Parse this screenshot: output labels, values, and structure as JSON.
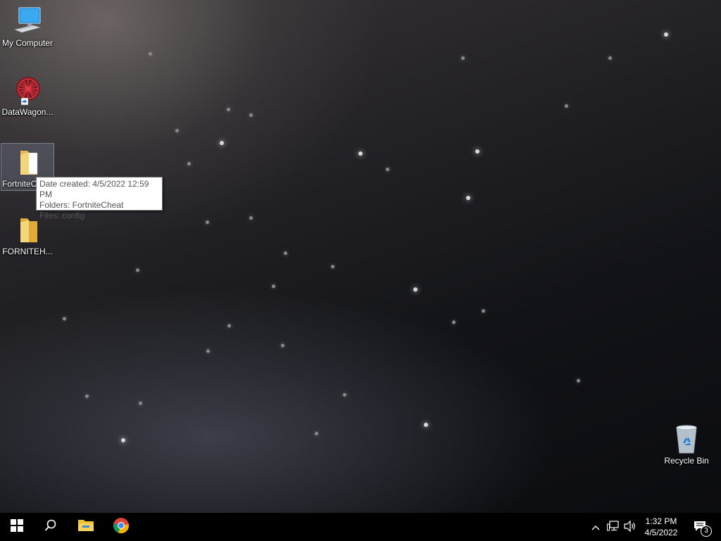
{
  "desktop": {
    "icons": [
      {
        "label": "My Computer"
      },
      {
        "label": "DataWagon..."
      },
      {
        "label": "FortniteC"
      },
      {
        "label": "FORNITEH..."
      },
      {
        "label": "Recycle Bin"
      }
    ],
    "tooltip": {
      "date_created": "Date created: 4/5/2022 12:59 PM",
      "folders": "Folders: FortniteCheat",
      "files": "Files: config"
    }
  },
  "taskbar": {
    "buttons": [
      "start-icon",
      "search-icon",
      "file-explorer-icon",
      "chrome-icon"
    ],
    "tray": {
      "icons": [
        "chevron-up-icon",
        "network-icon",
        "volume-icon"
      ],
      "time": "1:32 PM",
      "date": "4/5/2022",
      "notification_count": "3"
    }
  }
}
